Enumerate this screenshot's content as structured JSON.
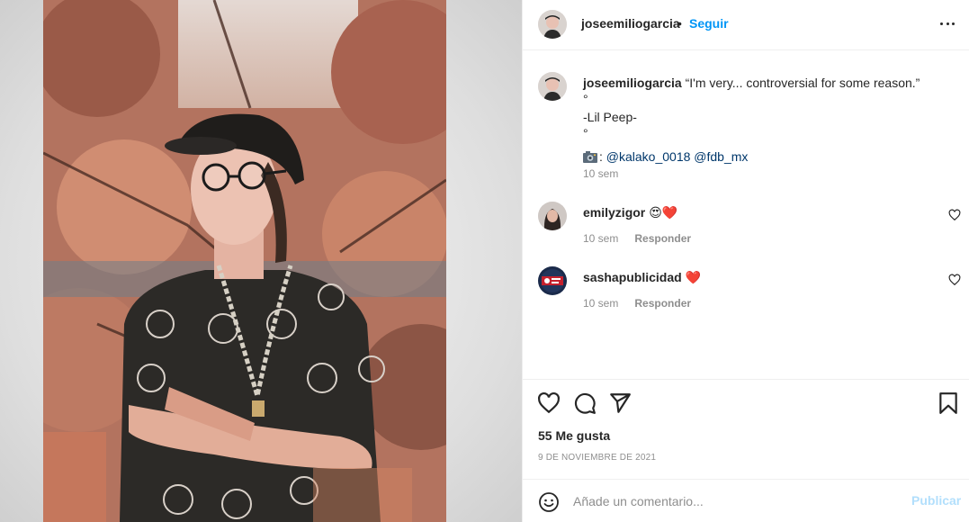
{
  "post": {
    "author": "joseemiliogarcia",
    "separator": "•",
    "follow_label": "Seguir",
    "more_icon": "more-horizontal-icon"
  },
  "caption": {
    "username": "joseemiliogarcia",
    "lines": [
      "“I'm very... controversial for some reason.”",
      "°",
      "-Lil Peep-",
      "°"
    ],
    "camera_icon": "camera-emoji-icon",
    "credit_separator": ":",
    "mentions": [
      "@kalako_0018",
      "@fdb_mx"
    ],
    "time": "10 sem"
  },
  "comments": [
    {
      "username": "emilyzigor",
      "text": "😍❤️",
      "time": "10 sem",
      "reply_label": "Responder"
    },
    {
      "username": "sashapublicidad",
      "text": "❤️",
      "time": "10 sem",
      "reply_label": "Responder"
    }
  ],
  "actions": {
    "icons": [
      "heart-icon",
      "comment-icon",
      "share-icon",
      "bookmark-icon"
    ],
    "likes": "55 Me gusta",
    "date": "9 DE NOVIEMBRE DE 2021"
  },
  "comment_box": {
    "placeholder": "Añade un comentario...",
    "publish_label": "Publicar",
    "emoji_icon": "smiley-icon"
  },
  "colors": {
    "accent": "#0095f6",
    "mention": "#00376b",
    "secondary_text": "#8e8e8e",
    "like_red": "#ed4956",
    "publish_disabled": "#b2dffc"
  }
}
